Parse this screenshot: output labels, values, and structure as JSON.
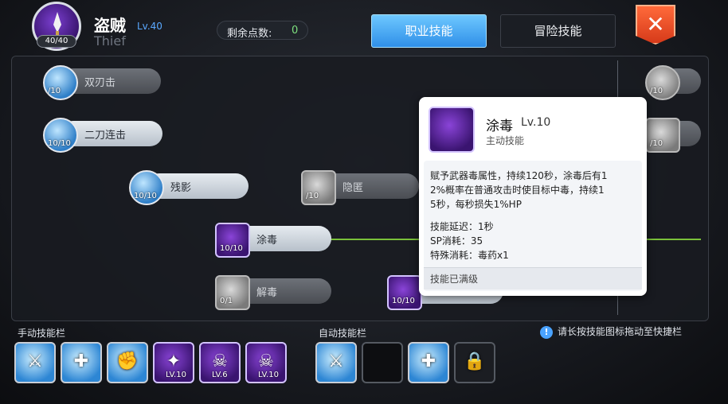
{
  "header": {
    "class_name": "盗贼",
    "class_level": "Lv.40",
    "class_en": "Thief",
    "job_level": "40/40",
    "points_label": "剩余点数:",
    "points_value": "0",
    "tab_job": "职业技能",
    "tab_adventure": "冒险技能",
    "close_icon": "close-icon"
  },
  "skills": [
    {
      "name": "双刃击",
      "level": "/10",
      "icon": "double-attack-icon"
    },
    {
      "name": "二刀连击",
      "level": "10/10",
      "icon": "double-strike-icon"
    },
    {
      "name": "残影",
      "level": "10/10",
      "icon": "afterimage-icon"
    },
    {
      "name": "隐匿",
      "level": "/10",
      "icon": "hiding-icon"
    },
    {
      "name": "涂毒",
      "level": "10/10",
      "icon": "envenom-icon"
    },
    {
      "name": "解毒",
      "level": "0/1",
      "icon": "detoxify-icon"
    },
    {
      "name": "",
      "level": "10/10",
      "icon": "venom-strike-icon"
    },
    {
      "name": "",
      "level": "/10",
      "icon": "side-skill-1-icon"
    },
    {
      "name": "",
      "level": "/10",
      "icon": "side-skill-2-icon"
    }
  ],
  "tooltip": {
    "name": "涂毒",
    "level": "Lv.10",
    "type": "主动技能",
    "desc_lines": [
      "赋予武器毒属性，持续120秒，涂毒后有1",
      "2%概率在普通攻击时使目标中毒，持续1",
      "5秒，每秒损失1%HP"
    ],
    "delay": "技能延迟：1秒",
    "sp": "SP消耗：35",
    "special": "特殊消耗：毒药x1",
    "footer": "技能已满级"
  },
  "bars": {
    "manual_label": "手动技能栏",
    "auto_label": "自动技能栏",
    "hint": "请长按技能图标拖动至快捷栏",
    "manual_slots": [
      {
        "icon": "sword-skill-icon",
        "level": ""
      },
      {
        "icon": "cross-blade-icon",
        "level": ""
      },
      {
        "icon": "fist-burst-icon",
        "level": ""
      },
      {
        "icon": "purple-claw-icon",
        "level": "LV.10"
      },
      {
        "icon": "skull-icon",
        "level": "LV.6"
      },
      {
        "icon": "poison-dagger-icon",
        "level": "LV.10"
      }
    ],
    "auto_slots": [
      {
        "icon": "sword-skill-icon"
      },
      {
        "icon": "empty-slot"
      },
      {
        "icon": "cross-blade-icon"
      },
      {
        "icon": "lock-icon"
      }
    ]
  }
}
